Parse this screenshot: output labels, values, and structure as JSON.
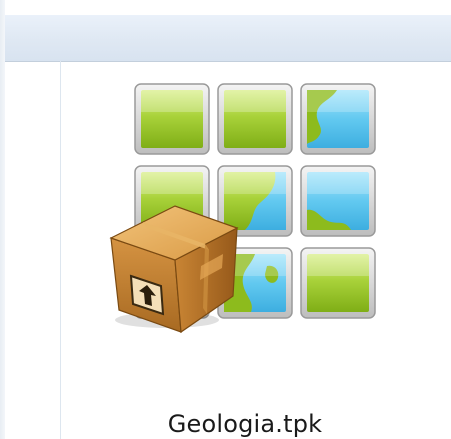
{
  "file": {
    "name": "Geologia.tpk",
    "icon": "tile-package-icon"
  },
  "colors": {
    "toolbar_top": "#eaf1fa",
    "toolbar_bottom": "#d8e3f0",
    "land_green": "#8dbb1d",
    "water_blue": "#5cc4ee",
    "box_brown": "#c98a3a"
  }
}
